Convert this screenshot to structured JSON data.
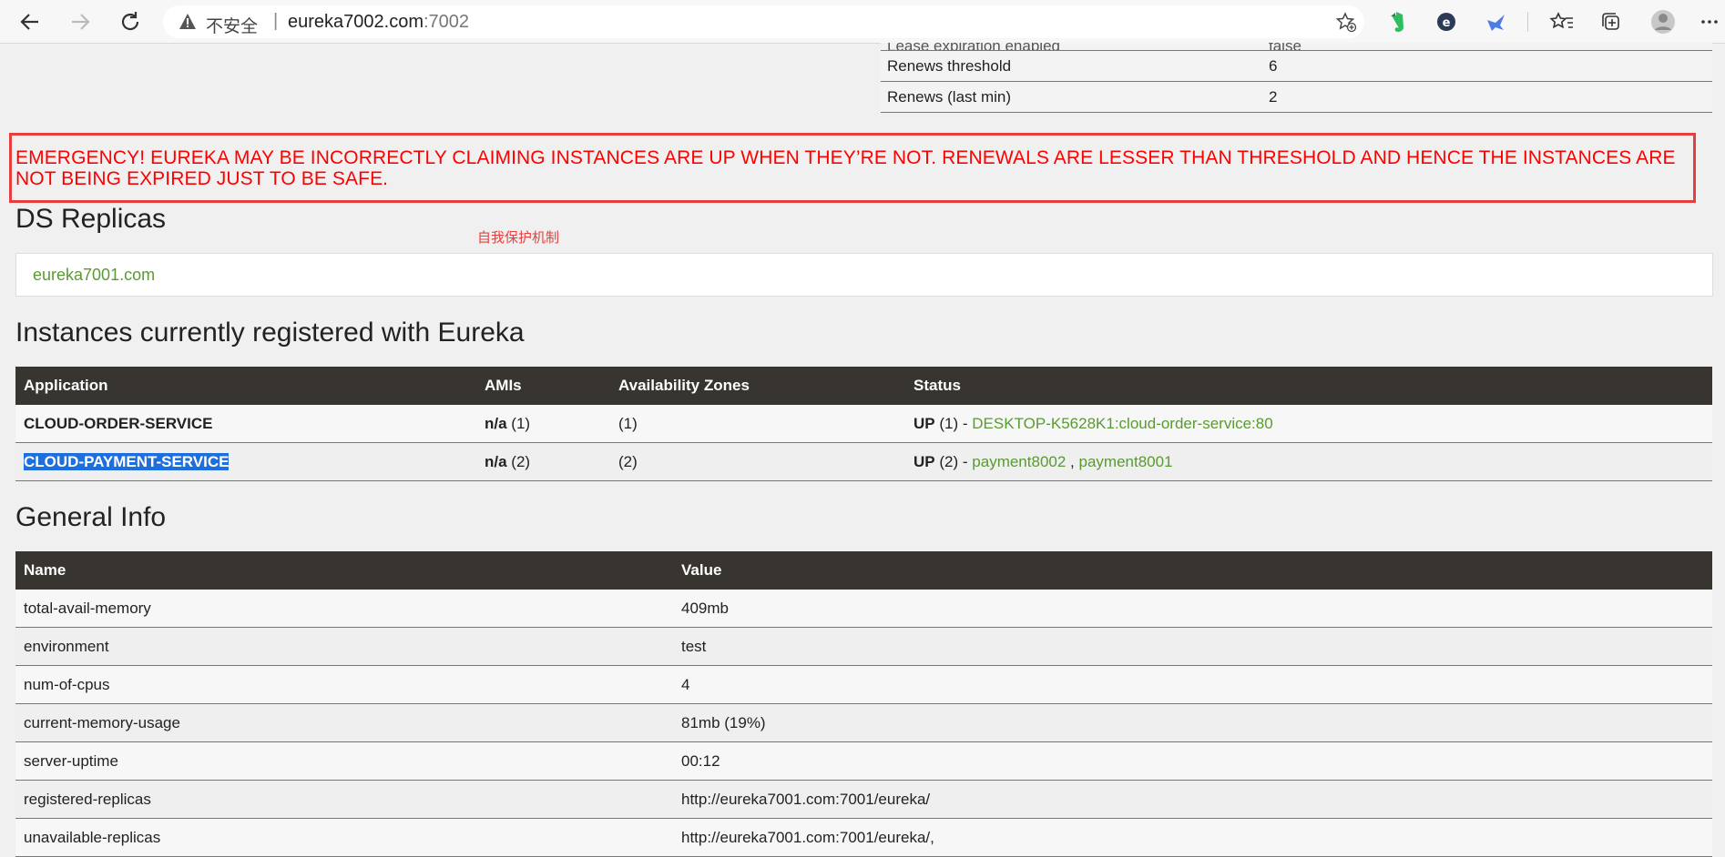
{
  "browser": {
    "security_label": "不安全",
    "url_host": "eureka7002.com",
    "url_port": ":7002"
  },
  "top_status": [
    {
      "name": "Lease expiration enabled",
      "value": "false"
    },
    {
      "name": "Renews threshold",
      "value": "6"
    },
    {
      "name": "Renews (last min)",
      "value": "2"
    }
  ],
  "emergency_message": "EMERGENCY! EUREKA MAY BE INCORRECTLY CLAIMING INSTANCES ARE UP WHEN THEY’RE NOT. RENEWALS ARE LESSER THAN THRESHOLD AND HENCE THE INSTANCES ARE NOT BEING EXPIRED JUST TO BE SAFE.",
  "ds_replicas": {
    "title": "DS Replicas",
    "annotation": "自我保护机制",
    "replicas": [
      "eureka7001.com"
    ]
  },
  "instances": {
    "title": "Instances currently registered with Eureka",
    "columns": [
      "Application",
      "AMIs",
      "Availability Zones",
      "Status"
    ],
    "rows": [
      {
        "application": "CLOUD-ORDER-SERVICE",
        "amis_bold": "n/a",
        "amis_count": "(1)",
        "zones": "(1)",
        "status_state": "UP",
        "status_count": "(1)",
        "status_sep": "-",
        "links": [
          "DESKTOP-K5628K1:cloud-order-service:80"
        ]
      },
      {
        "application": "CLOUD-PAYMENT-SERVICE",
        "amis_bold": "n/a",
        "amis_count": "(2)",
        "zones": "(2)",
        "status_state": "UP",
        "status_count": "(2)",
        "status_sep": "-",
        "links": [
          "payment8002",
          "payment8001"
        ],
        "link_sep": ","
      }
    ]
  },
  "general_info": {
    "title": "General Info",
    "columns": [
      "Name",
      "Value"
    ],
    "rows": [
      {
        "name": "total-avail-memory",
        "value": "409mb"
      },
      {
        "name": "environment",
        "value": "test"
      },
      {
        "name": "num-of-cpus",
        "value": "4"
      },
      {
        "name": "current-memory-usage",
        "value": "81mb (19%)"
      },
      {
        "name": "server-uptime",
        "value": "00:12"
      },
      {
        "name": "registered-replicas",
        "value": "http://eureka7001.com:7001/eureka/"
      },
      {
        "name": "unavailable-replicas",
        "value": "http://eureka7001.com:7001/eureka/,"
      }
    ]
  }
}
